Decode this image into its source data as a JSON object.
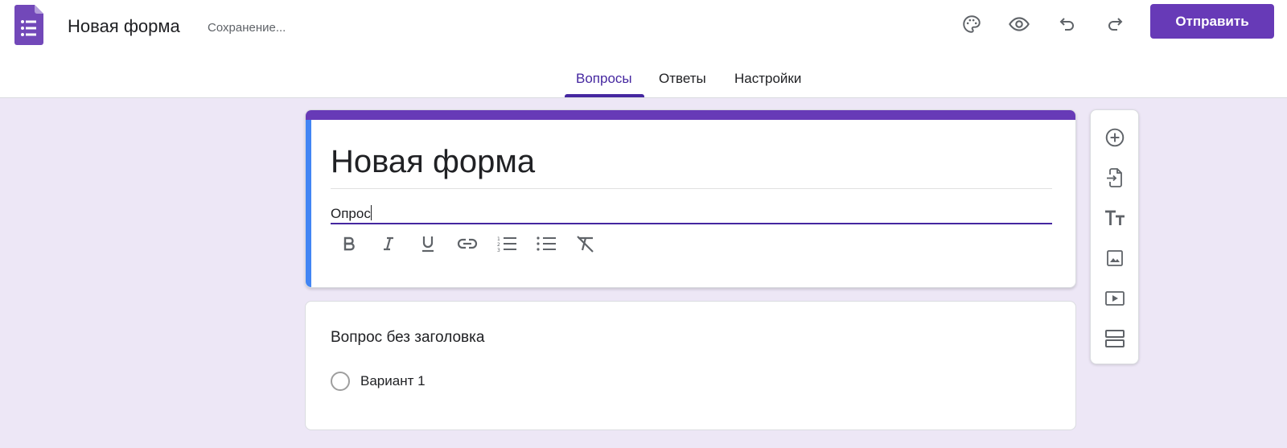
{
  "header": {
    "app_title": "Новая форма",
    "status": "Сохранение...",
    "send_label": "Отправить",
    "icons": [
      "palette-icon",
      "eye-icon",
      "undo-icon",
      "redo-icon"
    ]
  },
  "tabs": [
    {
      "label": "Вопросы",
      "active": true
    },
    {
      "label": "Ответы",
      "active": false
    },
    {
      "label": "Настройки",
      "active": false
    }
  ],
  "form": {
    "title": "Новая форма",
    "description": "Опрос",
    "format_tools": [
      "bold-icon",
      "italic-icon",
      "underline-icon",
      "link-icon",
      "numbered-list-icon",
      "bulleted-list-icon",
      "clear-format-icon"
    ]
  },
  "question": {
    "title": "Вопрос без заголовка",
    "options": [
      "Вариант 1"
    ]
  },
  "side_toolbar": [
    "add-question-icon",
    "import-questions-icon",
    "add-title-icon",
    "add-image-icon",
    "add-video-icon",
    "add-section-icon"
  ],
  "colors": {
    "accent": "#673ab7",
    "tab_active": "#4527a0",
    "background": "#ede7f6",
    "title_side_bar": "#4285f4"
  }
}
